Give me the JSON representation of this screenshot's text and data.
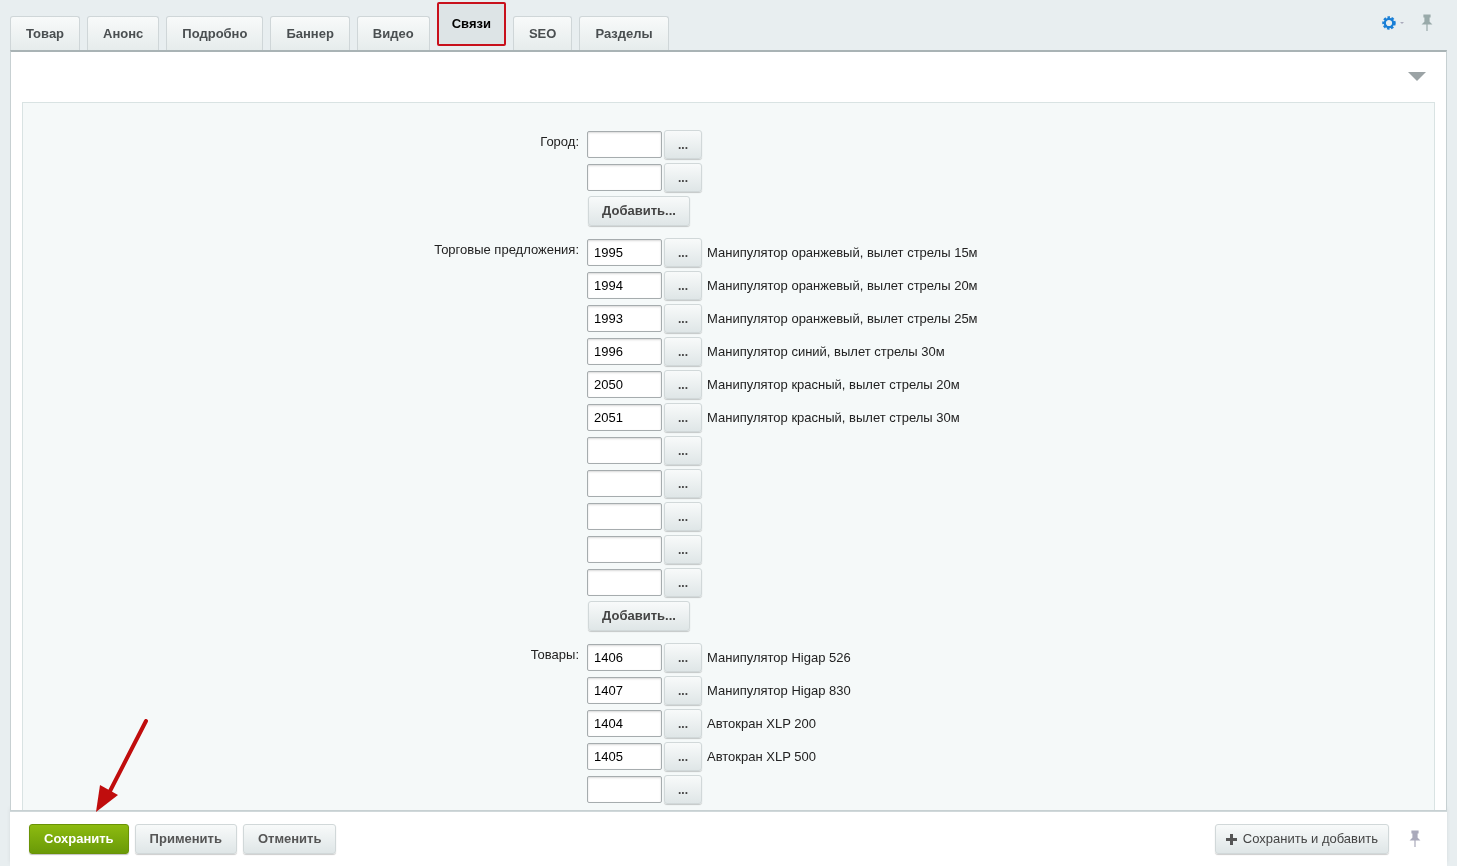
{
  "tabs": [
    {
      "label": "Товар",
      "selected": false
    },
    {
      "label": "Анонс",
      "selected": false
    },
    {
      "label": "Подробно",
      "selected": false
    },
    {
      "label": "Баннер",
      "selected": false
    },
    {
      "label": "Видео",
      "selected": false
    },
    {
      "label": "Связи",
      "selected": true
    },
    {
      "label": "SEO",
      "selected": false
    },
    {
      "label": "Разделы",
      "selected": false
    }
  ],
  "groups": [
    {
      "label": "Город:",
      "fields": [
        {
          "button": "..."
        },
        {
          "button": "..."
        }
      ],
      "add_button": "Добавить..."
    },
    {
      "label": "Торговые предложения:",
      "fields": [
        {
          "value": "1995",
          "button": "...",
          "description": "Манипулятор оранжевый, вылет стрелы 15м"
        },
        {
          "value": "1994",
          "button": "...",
          "description": "Манипулятор оранжевый, вылет стрелы 20м"
        },
        {
          "value": "1993",
          "button": "...",
          "description": "Манипулятор оранжевый, вылет стрелы 25м"
        },
        {
          "value": "1996",
          "button": "...",
          "description": "Манипулятор синий, вылет стрелы 30м"
        },
        {
          "value": "2050",
          "button": "...",
          "description": "Манипулятор красный, вылет стрелы 20м"
        },
        {
          "value": "2051",
          "button": "...",
          "description": "Манипулятор красный, вылет стрелы 30м"
        },
        {
          "button": "..."
        },
        {
          "button": "..."
        },
        {
          "button": "..."
        },
        {
          "button": "..."
        },
        {
          "button": "..."
        }
      ],
      "add_button": "Добавить..."
    },
    {
      "label": "Товары:",
      "fields": [
        {
          "value": "1406",
          "button": "...",
          "description": "Манипулятор Higap 526"
        },
        {
          "value": "1407",
          "button": "...",
          "description": "Манипулятор Higap 830"
        },
        {
          "value": "1404",
          "button": "...",
          "description": "Автокран XLP 200"
        },
        {
          "value": "1405",
          "button": "...",
          "description": "Автокран XLP 500"
        },
        {
          "button": "..."
        }
      ]
    }
  ],
  "footer": {
    "buttons": [
      {
        "label": "Сохранить",
        "kind": "primary"
      },
      {
        "label": "Применить",
        "kind": "normal"
      },
      {
        "label": "Отменить",
        "kind": "normal"
      }
    ],
    "save_and_add": "Сохранить и добавить"
  }
}
